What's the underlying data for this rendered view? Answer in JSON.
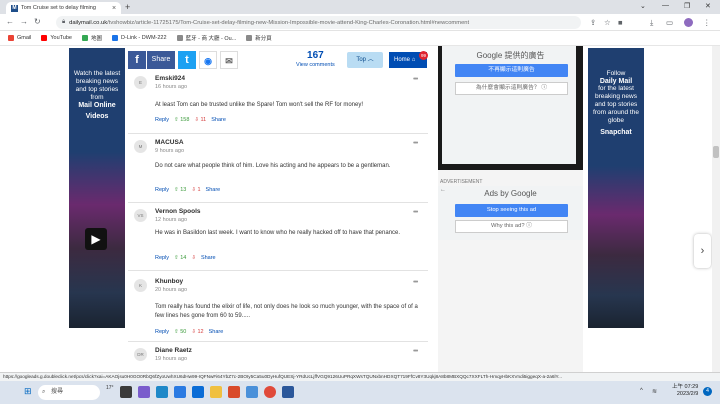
{
  "browser": {
    "tab_title": "Tom Cruise set to delay filming",
    "tab_close": "×",
    "new_tab": "+",
    "address_host": "dailymail.co.uk",
    "address_path": "/tvshowbiz/article-11725175/Tom-Cruise-set-delay-filming-new-Mission-Impossible-movie-attend-King-Charles-Coronation.html#newcomment",
    "status_url": "https://googleads.g.doubleclick.net/pcs/click?xai=AKAOjsu0H0GO0RbQ6fZyoUwhXU6dHw99-IQFNwFi64YbZ7c-2BOIy5Ca5u0DyHufQUESj-YRdUcLjffVGQ9126UuPRqXWsTQUNxbnHDXQT719FfCv8Y3Uqkj8A8b8MBXQQc7XXFLTh-HmqyHbKXVndi5iggeqX-a-2a6lY..."
  },
  "bookmarks": [
    {
      "label": "Gmail",
      "color": "#ea4335"
    },
    {
      "label": "YouTube",
      "color": "#ff0000"
    },
    {
      "label": "地圖",
      "color": "#34a853"
    },
    {
      "label": "D-Link - DWM-222",
      "color": "#1a73e8"
    },
    {
      "label": "藍牙 - 商 大廳 - Ou...",
      "color": "#8a8a8a"
    },
    {
      "label": "新分頁",
      "color": "#8a8a8a"
    }
  ],
  "share_bar": {
    "share_label": "Share",
    "comment_count": "167",
    "view_comments": "View comments",
    "top_label": "Top",
    "home_label": "Home",
    "home_badge": "99"
  },
  "left_ad": {
    "line1": "Watch the latest breaking news and top stories from",
    "brand": "Mail Online",
    "media": "Videos"
  },
  "right_ad": {
    "line1": "Follow",
    "brand": "Daily Mail",
    "line2": "for the latest breaking news and top stories from around the globe",
    "media": "Snapchat"
  },
  "comments": [
    {
      "initials": "E",
      "name": "Emski924",
      "time": "16 hours ago",
      "text": "At least Tom can be trusted unlike the Spare! Tom won't sell the RF for money!",
      "reply": "Reply",
      "up": "158",
      "down": "11",
      "share": "Share"
    },
    {
      "initials": "M",
      "name": "MACUSA",
      "time": "9 hours ago",
      "text": "Do not care what people think of him.  Love his acting and he appears to be a gentleman.",
      "reply": "Reply",
      "up": "13",
      "down": "1",
      "share": "Share"
    },
    {
      "initials": "VS",
      "name": "Vernon Spools",
      "time": "12 hours ago",
      "text": "He was  in Basildon last week. I want to know who he really hacked off to have that penance.",
      "reply": "Reply",
      "up": "14",
      "down": "",
      "share": "Share"
    },
    {
      "initials": "K",
      "name": "Khunboy",
      "time": "20 hours ago",
      "text": "Tom really has found the elixir of life, not only does he look so much younger, with the space of of a few lines hes gone from 60 to 59.....",
      "reply": "Reply",
      "up": "50",
      "down": "12",
      "share": "Share"
    },
    {
      "initials": "DR",
      "name": "Diane Raetz",
      "time": "19 hours ago",
      "text": "",
      "reply": "",
      "up": "",
      "down": "",
      "share": ""
    }
  ],
  "google_ads": {
    "top_heading": "Google 提供的廣告",
    "top_stop": "不再顯示這則廣告",
    "top_why": "為什麼會顯示這則廣告？ ⓘ",
    "advertisement": "ADVERTISEMENT",
    "ads_by": "Ads by Google",
    "stop": "Stop seeing this ad",
    "why": "Why this ad? ⓘ"
  },
  "taskbar": {
    "search": "搜尋",
    "time": "上午 07:29",
    "date": "2023/2/9",
    "temp": "17°"
  }
}
